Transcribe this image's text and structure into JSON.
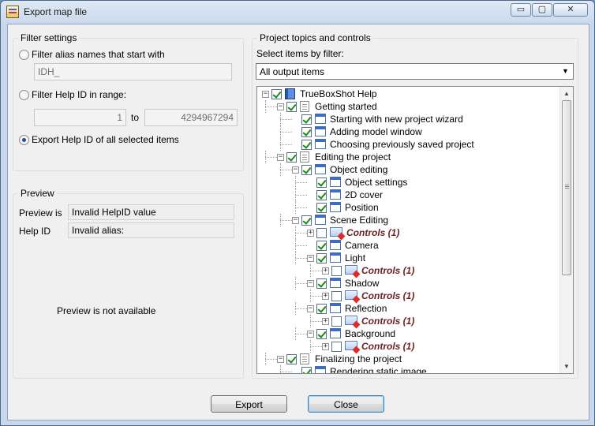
{
  "window": {
    "title": "Export map file"
  },
  "title_buttons": {
    "min": "▭",
    "max": "▢",
    "close": "✕"
  },
  "filter_settings": {
    "title": "Filter settings",
    "alias_option_label": "Filter alias names that start with",
    "alias_value": "IDH_",
    "range_option_label": "Filter Help ID in range:",
    "range_from": "1",
    "range_to_label": "to",
    "range_to": "4294967294",
    "all_option_label": "Export Help ID of all selected items",
    "selected_option": "all"
  },
  "preview": {
    "title": "Preview",
    "preview_is_label": "Preview is",
    "preview_is_value": "Invalid HelpID value",
    "help_id_label": "Help ID",
    "help_id_value": "Invalid alias:",
    "message": "Preview is not available"
  },
  "topics": {
    "title": "Project topics and controls",
    "select_label": "Select items by filter:",
    "filter_value": "All output items",
    "tree": [
      {
        "text": "TrueBoxShot Help",
        "level": 0,
        "icon": "book-icon",
        "checked": true,
        "expander": "−",
        "ctrl": false
      },
      {
        "text": "Getting started",
        "level": 1,
        "icon": "page-icon",
        "checked": true,
        "expander": "−",
        "ctrl": false
      },
      {
        "text": "Starting with new project wizard",
        "level": 2,
        "icon": "window-icon",
        "checked": true,
        "expander": "",
        "ctrl": false
      },
      {
        "text": "Adding model window",
        "level": 2,
        "icon": "window-icon",
        "checked": true,
        "expander": "",
        "ctrl": false
      },
      {
        "text": "Choosing previously saved project",
        "level": 2,
        "icon": "window-icon",
        "checked": true,
        "expander": "",
        "ctrl": false
      },
      {
        "text": "Editing the project",
        "level": 1,
        "icon": "page-icon",
        "checked": true,
        "expander": "−",
        "ctrl": false
      },
      {
        "text": "Object editing",
        "level": 2,
        "icon": "window-icon",
        "checked": true,
        "expander": "−",
        "ctrl": false
      },
      {
        "text": "Object settings",
        "level": 3,
        "icon": "window-icon",
        "checked": true,
        "expander": "",
        "ctrl": false
      },
      {
        "text": "2D cover",
        "level": 3,
        "icon": "window-icon",
        "checked": true,
        "expander": "",
        "ctrl": false
      },
      {
        "text": "Position",
        "level": 3,
        "icon": "window-icon",
        "checked": true,
        "expander": "",
        "ctrl": false
      },
      {
        "text": "Scene Editing",
        "level": 2,
        "icon": "window-icon",
        "checked": true,
        "expander": "−",
        "ctrl": false
      },
      {
        "text": "Controls (1)",
        "level": 3,
        "icon": "controls-icon",
        "checked": false,
        "expander": "+",
        "ctrl": true
      },
      {
        "text": "Camera",
        "level": 3,
        "icon": "window-icon",
        "checked": true,
        "expander": "",
        "ctrl": false
      },
      {
        "text": "Light",
        "level": 3,
        "icon": "window-icon",
        "checked": true,
        "expander": "−",
        "ctrl": false
      },
      {
        "text": "Controls (1)",
        "level": 4,
        "icon": "controls-icon",
        "checked": false,
        "expander": "+",
        "ctrl": true
      },
      {
        "text": "Shadow",
        "level": 3,
        "icon": "window-icon",
        "checked": true,
        "expander": "−",
        "ctrl": false
      },
      {
        "text": "Controls (1)",
        "level": 4,
        "icon": "controls-icon",
        "checked": false,
        "expander": "+",
        "ctrl": true
      },
      {
        "text": "Reflection",
        "level": 3,
        "icon": "window-icon",
        "checked": true,
        "expander": "−",
        "ctrl": false
      },
      {
        "text": "Controls (1)",
        "level": 4,
        "icon": "controls-icon",
        "checked": false,
        "expander": "+",
        "ctrl": true
      },
      {
        "text": "Background",
        "level": 3,
        "icon": "window-icon",
        "checked": true,
        "expander": "−",
        "ctrl": false
      },
      {
        "text": "Controls (1)",
        "level": 4,
        "icon": "controls-icon",
        "checked": false,
        "expander": "+",
        "ctrl": true
      },
      {
        "text": "Finalizing the project",
        "level": 1,
        "icon": "page-icon",
        "checked": true,
        "expander": "−",
        "ctrl": false
      },
      {
        "text": "Rendering static image",
        "level": 2,
        "icon": "window-icon",
        "checked": true,
        "expander": "",
        "ctrl": false
      }
    ]
  },
  "buttons": {
    "export": "Export",
    "close": "Close"
  }
}
